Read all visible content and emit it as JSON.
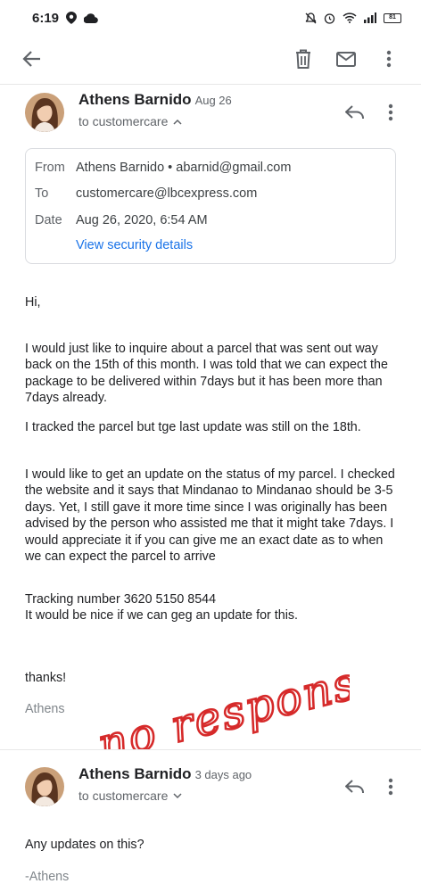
{
  "status_bar": {
    "time": "6:19",
    "battery": "81"
  },
  "toolbar": {
    "back_icon": "arrow-left-icon",
    "delete_icon": "trash-icon",
    "mail_icon": "mail-icon",
    "more_icon": "more-vert-icon"
  },
  "message1": {
    "sender": "Athens Barnido",
    "date": "Aug 26",
    "to": "to customercare",
    "details": {
      "from_label": "From",
      "from_value": "Athens Barnido • abarnid@gmail.com",
      "to_label": "To",
      "to_value": "customercare@lbcexpress.com",
      "date_label": "Date",
      "date_value": "Aug 26, 2020, 6:54 AM",
      "security_link": "View security details"
    },
    "body": {
      "greeting": "Hi,",
      "p1": "I would just like to inquire about a parcel that was sent out way back on the 15th of this month. I was told that we can expect the package to be delivered within 7days but it has been more than 7days already.",
      "p2": "I tracked the parcel but tge last update was still on the 18th.",
      "p3": "I would like to get an update on the status of my parcel. I checked the website and it says that Mindanao to Mindanao should be 3-5 days. Yet, I still gave it more time since I was originally has been advised by the person who assisted me that it might take 7days.  I would appreciate it if you can give me an exact date as to when we can expect the parcel to arrive",
      "tracking": "Tracking number 3620 5150 8544",
      "p4": "It would be nice if we can geg an update for this.",
      "thanks": "thanks!",
      "signature": "Athens"
    }
  },
  "annotation": "no response",
  "message2": {
    "sender": "Athens Barnido",
    "date": "3 days ago",
    "to": "to customercare",
    "body": {
      "line1": "Any updates on this?",
      "signature": "-Athens"
    }
  }
}
